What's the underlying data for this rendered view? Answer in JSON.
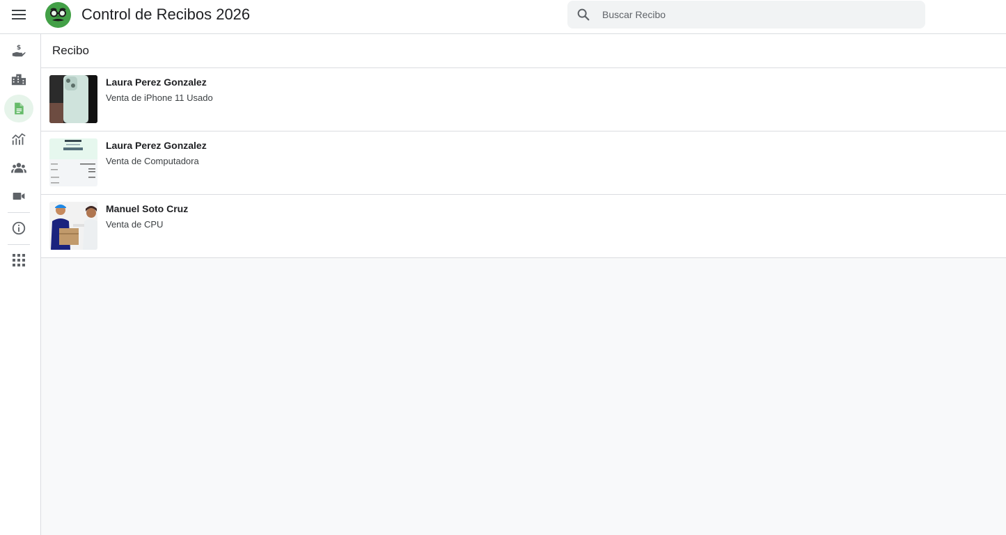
{
  "header": {
    "title": "Control de Recibos 2026",
    "menu_icon": "menu-icon",
    "logo_icon": "disguise-glasses-icon"
  },
  "search": {
    "placeholder": "Buscar Recibo",
    "value": "",
    "icon": "search-icon"
  },
  "sidebar": {
    "items": [
      {
        "name": "payments",
        "icon": "hand-money-icon",
        "active": false
      },
      {
        "name": "companies",
        "icon": "buildings-icon",
        "active": false
      },
      {
        "name": "receipts",
        "icon": "document-icon",
        "active": true
      },
      {
        "name": "analytics",
        "icon": "chart-icon",
        "active": false
      },
      {
        "name": "clients",
        "icon": "people-icon",
        "active": false
      },
      {
        "name": "video",
        "icon": "video-icon",
        "active": false
      },
      {
        "name": "info",
        "icon": "info-icon",
        "active": false
      },
      {
        "name": "apps",
        "icon": "apps-grid-icon",
        "active": false
      }
    ]
  },
  "main": {
    "section_title": "Recibo",
    "receipts": [
      {
        "name": "Laura Perez Gonzalez",
        "description": "Venta de iPhone 11 Usado"
      },
      {
        "name": "Laura Perez Gonzalez",
        "description": "Venta de Computadora"
      },
      {
        "name": "Manuel Soto Cruz",
        "description": "Venta de CPU"
      }
    ]
  },
  "colors": {
    "accent": "#4caf50",
    "active_bg": "#e6f4ea",
    "border": "#dadce0",
    "background": "#f8f9fa"
  }
}
